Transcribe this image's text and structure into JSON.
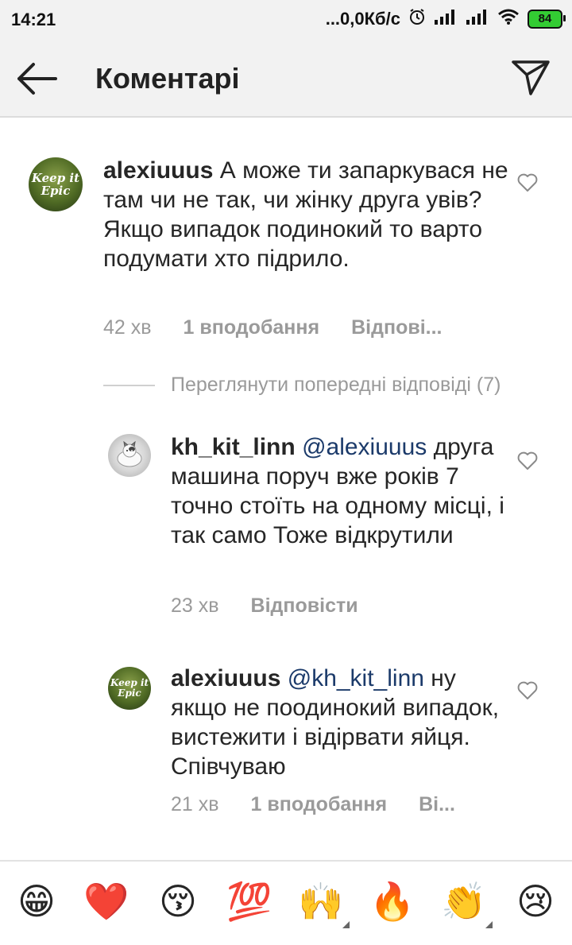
{
  "status_bar": {
    "time": "14:21",
    "network_speed": "...0,0Кб/с",
    "battery": "84"
  },
  "header": {
    "title": "Коментарі",
    "back_icon": "arrow-left-icon",
    "send_icon": "send-icon"
  },
  "comments": [
    {
      "username": "alexiuuus",
      "avatar_text": "Keep it Epic",
      "text": "А може ти запаркувася не там чи не так, чи жінку друга увів? Якщо випадок подинокий то варто подумати хто підрило.",
      "time": "42 хв",
      "likes": "1 вподобання",
      "reply": "Відпові..."
    },
    {
      "username": "kh_kit_linn",
      "mention": "@alexiuuus",
      "text": "друга машина поруч вже років 7 точно стоїть на одному місці, і так само Тоже відкрутили",
      "time": "23 хв",
      "reply": "Відповісти"
    },
    {
      "username": "alexiuuus",
      "avatar_text": "Keep it Epic",
      "mention": "@kh_kit_linn",
      "text": "ну якщо не поодинокий випадок, вистежити і відірвати яйця. Співчуваю",
      "time": "21 хв",
      "likes": "1 вподобання",
      "reply": "Ві..."
    }
  ],
  "view_previous": "Переглянути попередні відповіді (7)",
  "emoji_bar": [
    {
      "char": "😁",
      "name": "grinning-emoji"
    },
    {
      "char": "❤️",
      "name": "heart-emoji"
    },
    {
      "char": "😚",
      "name": "kissing-emoji"
    },
    {
      "char": "💯",
      "name": "hundred-emoji"
    },
    {
      "char": "🙌",
      "name": "raised-hands-emoji"
    },
    {
      "char": "🔥",
      "name": "fire-emoji"
    },
    {
      "char": "👏",
      "name": "clapping-emoji"
    },
    {
      "char": "😢",
      "name": "sad-emoji"
    }
  ],
  "colors": {
    "header_bg": "#f2f2f2",
    "text": "#262626",
    "meta": "#9a9a9a",
    "mention": "#1b3a6a"
  }
}
